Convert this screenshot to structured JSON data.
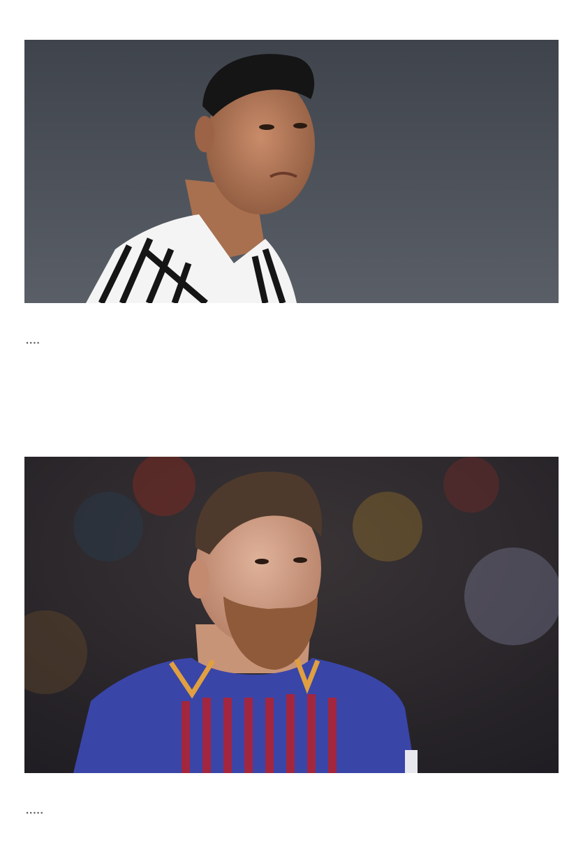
{
  "feed": {
    "posts": [
      {
        "image": {
          "subject": "player-portrait-striped-jersey",
          "background_color": "#4a4f57",
          "jersey_colors": [
            "#ffffff",
            "#1a1a1a"
          ]
        },
        "caption": "...."
      },
      {
        "image": {
          "subject": "player-portrait-blue-red-jersey",
          "background_color": "#2b2a2e",
          "jersey_colors": [
            "#3a45a8",
            "#a3263f",
            "#e0a040"
          ]
        },
        "caption": "....."
      }
    ]
  }
}
